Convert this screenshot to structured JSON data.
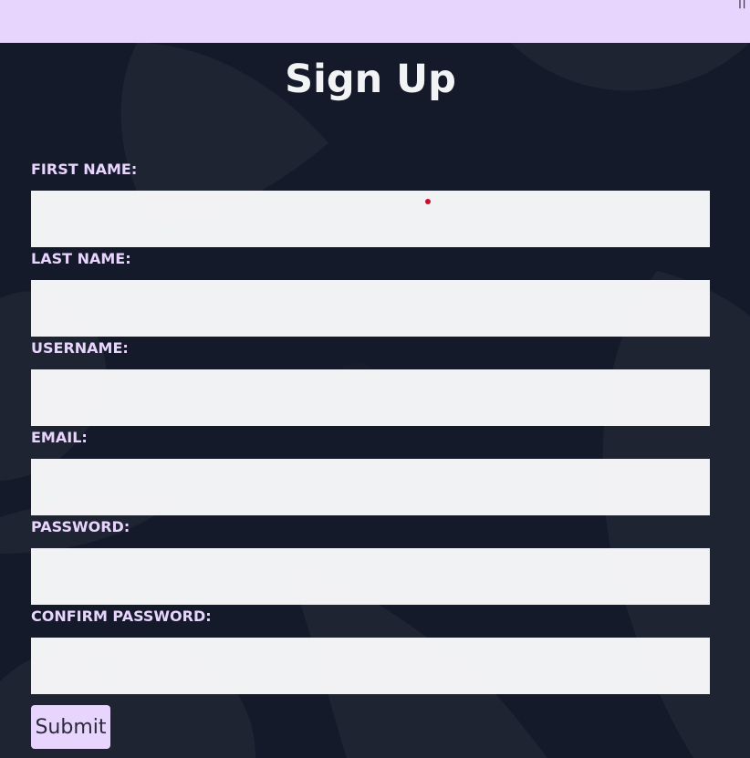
{
  "header": {
    "title": "Sign Up"
  },
  "form": {
    "fields": [
      {
        "label": "FIRST NAME:",
        "value": "",
        "type": "text"
      },
      {
        "label": "LAST NAME:",
        "value": "",
        "type": "text"
      },
      {
        "label": "USERNAME:",
        "value": "",
        "type": "text"
      },
      {
        "label": "EMAIL:",
        "value": "",
        "type": "email"
      },
      {
        "label": "PASSWORD:",
        "value": "",
        "type": "password"
      },
      {
        "label": "CONFIRM PASSWORD:",
        "value": "",
        "type": "password"
      }
    ],
    "submit_label": "Submit"
  },
  "colors": {
    "accent": "#e8d5fd",
    "background": "#141a2a",
    "ghost": "#1f2433",
    "input": "#f3f3f3"
  }
}
